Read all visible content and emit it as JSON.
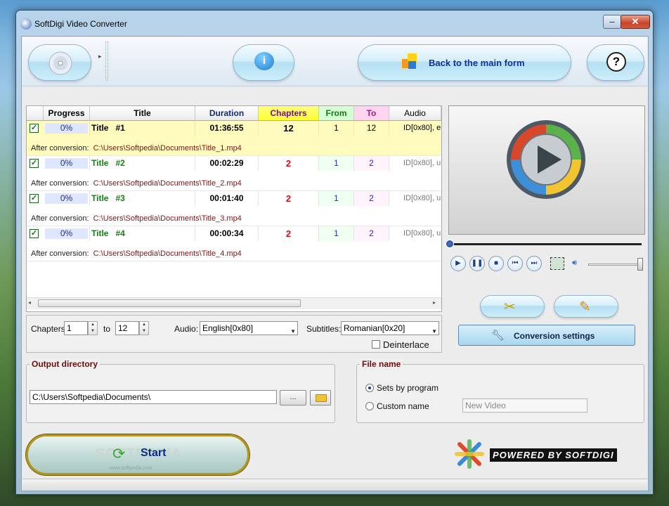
{
  "window": {
    "title": "SoftDigi Video Converter",
    "minimize": "–",
    "maximize": "□",
    "close": "✕"
  },
  "toolbar": {
    "back_label": "Back to the main form",
    "info_glyph": "i",
    "help_glyph": "?",
    "grip": "▸"
  },
  "grid": {
    "columns": [
      "Progress",
      "Title",
      "Duration",
      "Chapters",
      "From",
      "To",
      "Audio"
    ],
    "rows": [
      {
        "progress": "0%",
        "title": "Title",
        "num": "#1",
        "duration": "01:36:55",
        "chapters": "12",
        "from": "1",
        "to": "12",
        "audio": "ID[0x80], e",
        "after_label": "After conversion:",
        "after_path": "C:\\Users\\Softpedia\\Documents\\Title_1.mp4"
      },
      {
        "progress": "0%",
        "title": "Title",
        "num": "#2",
        "duration": "00:02:29",
        "chapters": "2",
        "from": "1",
        "to": "2",
        "audio": "ID[0x80], u",
        "after_label": "After conversion:",
        "after_path": "C:\\Users\\Softpedia\\Documents\\Title_2.mp4"
      },
      {
        "progress": "0%",
        "title": "Title",
        "num": "#3",
        "duration": "00:01:40",
        "chapters": "2",
        "from": "1",
        "to": "2",
        "audio": "ID[0x80], u",
        "after_label": "After conversion:",
        "after_path": "C:\\Users\\Softpedia\\Documents\\Title_3.mp4"
      },
      {
        "progress": "0%",
        "title": "Title",
        "num": "#4",
        "duration": "00:00:34",
        "chapters": "2",
        "from": "1",
        "to": "2",
        "audio": "ID[0x80], u",
        "after_label": "After conversion:",
        "after_path": "C:\\Users\\Softpedia\\Documents\\Title_4.mp4"
      }
    ]
  },
  "chapter_bar": {
    "chapters_label": "Chapters",
    "from_value": "1",
    "to_label": "to",
    "to_value": "12",
    "audio_label": "Audio:",
    "audio_value": "English[0x80]",
    "subtitles_label": "Subtitles:",
    "subtitles_value": "Romanian[0x20]",
    "deinterlace_label": "Deinterlace"
  },
  "output": {
    "title": "Output directory",
    "path": "C:\\Users\\Softpedia\\Documents\\",
    "browse_label": "..."
  },
  "filename": {
    "title": "File name",
    "option_program": "Sets by program",
    "option_custom": "Custom name",
    "custom_placeholder": "New Video"
  },
  "side": {
    "conversion_settings": "Conversion settings"
  },
  "start": {
    "label": "Start",
    "watermark": "SOFTPEDIA",
    "watermark_small": "www.softpedia.com"
  },
  "brand": {
    "powered": "POWERED BY SOFTDIGI"
  },
  "colors": {
    "chapters_header": "#ffff40",
    "from_header": "#d6ffd6",
    "to_header": "#ffd6f0",
    "selected_row": "#fffbbf",
    "title_green": "#1a7a1a",
    "chapter_red": "#c0141c",
    "from_blue": "#2a2aa8"
  }
}
